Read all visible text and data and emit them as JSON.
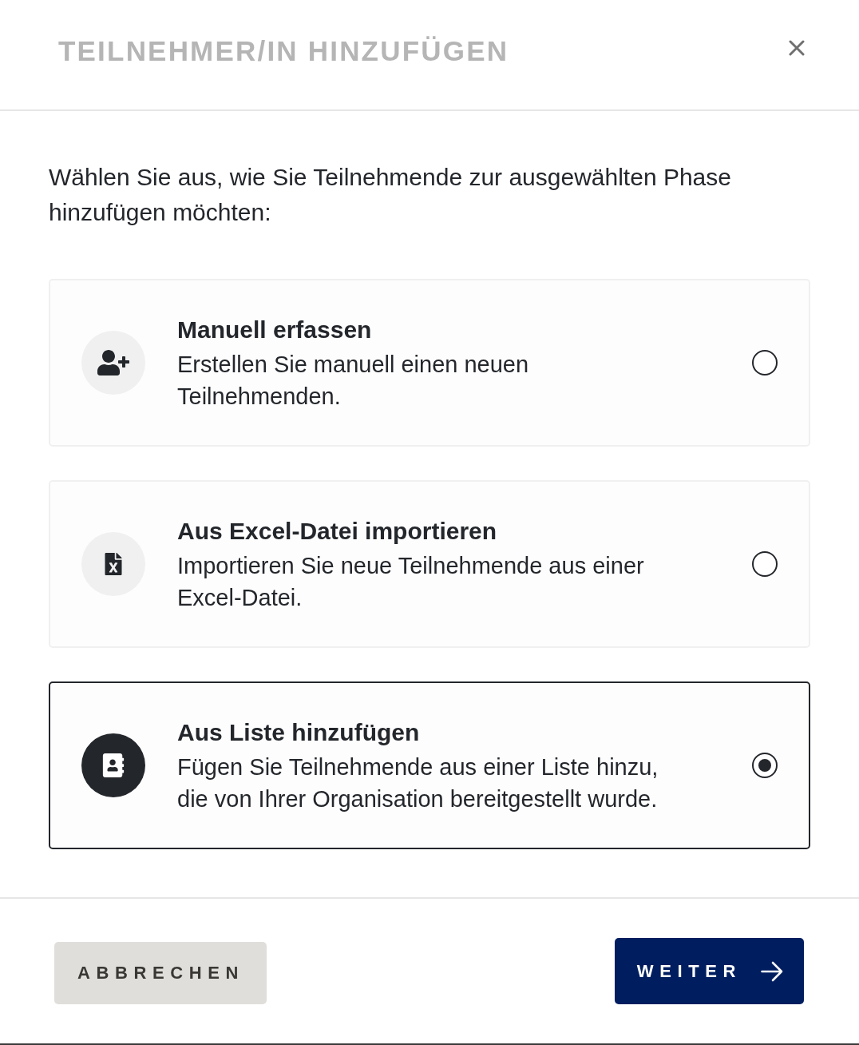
{
  "dialog": {
    "title": "TEILNEHMER/IN HINZUFÜGEN"
  },
  "intro": "Wählen Sie aus, wie Sie Teilnehmende zur ausgewählten Phase hinzufügen möchten:",
  "options": [
    {
      "kind": "manual",
      "title": "Manuell erfassen",
      "description": "Erstellen Sie manuell einen neuen Teilnehmenden.",
      "selected": false
    },
    {
      "kind": "excel",
      "title": "Aus Excel-Datei importieren",
      "description": "Importieren Sie neue Teilnehmende aus einer Excel-Datei.",
      "selected": false
    },
    {
      "kind": "list",
      "title": "Aus Liste hinzufügen",
      "description": "Fügen Sie Teilnehmende aus einer Liste hinzu, die von Ihrer Organisation bereitgestellt wurde.",
      "selected": true
    }
  ],
  "buttons": [
    {
      "kind": "secondary",
      "label": "ABBRECHEN"
    },
    {
      "kind": "primary",
      "label": "WEITER"
    }
  ]
}
